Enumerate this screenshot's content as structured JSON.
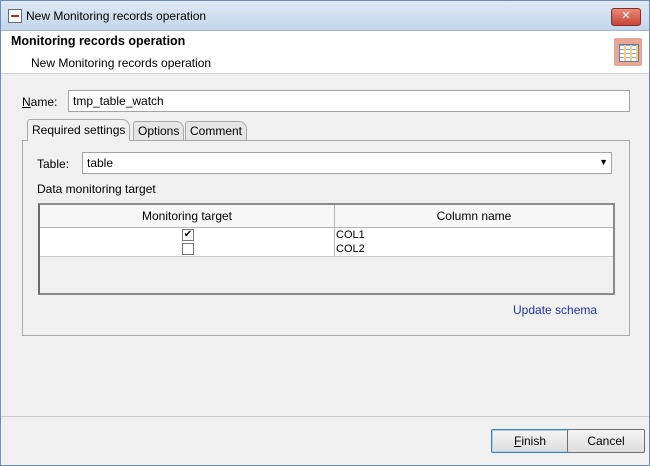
{
  "window": {
    "title": "New Monitoring records operation",
    "close_glyph": "✕"
  },
  "header": {
    "title": "Monitoring records operation",
    "subtitle": "New Monitoring records operation",
    "icon": "table-icon"
  },
  "form": {
    "name_label_mnemonic": "N",
    "name_label_rest": "ame:",
    "name_value": "tmp_table_watch"
  },
  "tabs": [
    {
      "label": "Required settings",
      "active": true
    },
    {
      "label": "Options",
      "active": false
    },
    {
      "label": "Comment",
      "active": false
    }
  ],
  "required": {
    "table_label": "Table:",
    "table_value": "table",
    "dropdown_glyph": "▼",
    "section_label": "Data monitoring target",
    "columns": [
      "Monitoring target",
      "Column name"
    ],
    "rows": [
      {
        "checked": true,
        "check_glyph": "✔",
        "column": "COL1"
      },
      {
        "checked": false,
        "check_glyph": "",
        "column": "COL2"
      }
    ],
    "update_link": "Update schema"
  },
  "buttons": {
    "finish_mnemonic": "F",
    "finish_rest": "inish",
    "cancel": "Cancel"
  },
  "colors": {
    "link": "#2533a8",
    "close_button": "#c74538",
    "titlebar": "#c4d6ec"
  }
}
